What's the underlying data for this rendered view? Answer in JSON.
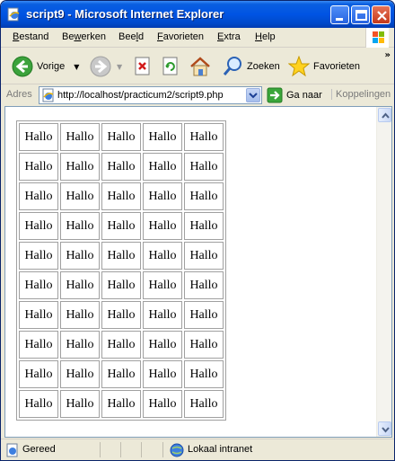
{
  "window": {
    "title": "script9 - Microsoft Internet Explorer"
  },
  "menu": [
    "Bestand",
    "Bewerken",
    "Beeld",
    "Favorieten",
    "Extra",
    "Help"
  ],
  "toolbar": {
    "back_label": "Vorige",
    "search_label": "Zoeken",
    "favorites_label": "Favorieten"
  },
  "address": {
    "label": "Adres",
    "url": "http://localhost/practicum2/script9.php",
    "go_label": "Ga naar",
    "links_label": "Koppelingen"
  },
  "table": {
    "rows": [
      [
        "Hallo",
        "Hallo",
        "Hallo",
        "Hallo",
        "Hallo"
      ],
      [
        "Hallo",
        "Hallo",
        "Hallo",
        "Hallo",
        "Hallo"
      ],
      [
        "Hallo",
        "Hallo",
        "Hallo",
        "Hallo",
        "Hallo"
      ],
      [
        "Hallo",
        "Hallo",
        "Hallo",
        "Hallo",
        "Hallo"
      ],
      [
        "Hallo",
        "Hallo",
        "Hallo",
        "Hallo",
        "Hallo"
      ],
      [
        "Hallo",
        "Hallo",
        "Hallo",
        "Hallo",
        "Hallo"
      ],
      [
        "Hallo",
        "Hallo",
        "Hallo",
        "Hallo",
        "Hallo"
      ],
      [
        "Hallo",
        "Hallo",
        "Hallo",
        "Hallo",
        "Hallo"
      ],
      [
        "Hallo",
        "Hallo",
        "Hallo",
        "Hallo",
        "Hallo"
      ],
      [
        "Hallo",
        "Hallo",
        "Hallo",
        "Hallo",
        "Hallo"
      ]
    ]
  },
  "status": {
    "text": "Gereed",
    "zone": "Lokaal intranet"
  }
}
